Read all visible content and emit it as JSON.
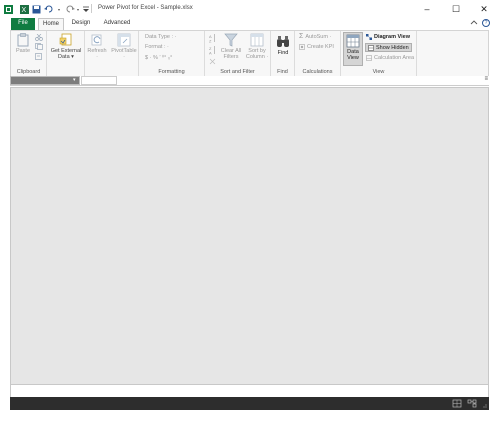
{
  "window": {
    "title": "Power Pivot for Excel - Sample.xlsx",
    "minimize_glyph": "–",
    "maximize_glyph": "☐",
    "close_glyph": "✕"
  },
  "quick_access": [
    "excel-logo-icon",
    "save-icon",
    "undo-icon",
    "redo-icon",
    "customize-icon"
  ],
  "tabs": [
    {
      "label": "File",
      "active": false
    },
    {
      "label": "Home",
      "active": true
    },
    {
      "label": "Design",
      "active": false
    },
    {
      "label": "Advanced",
      "active": false
    }
  ],
  "help_glyph": "?",
  "ribbon": {
    "clipboard": {
      "paste": "Paste",
      "label": "Clipboard"
    },
    "get_external": {
      "label": "Get External\nData ▾"
    },
    "refresh": {
      "label": "Refresh\n·"
    },
    "pivottable": {
      "label": "PivotTable\n·"
    },
    "formatting": {
      "data_type": "Data Type : ·",
      "format": "Format : ·",
      "currency_row": "$ ·  %  ’  ⁰°  ₀°",
      "label": "Formatting"
    },
    "sort_filter": {
      "clear_filters": "Clear All\nFilters",
      "sort_by_column": "Sort by\nColumn ·",
      "label": "Sort and Filter"
    },
    "find": {
      "button": "Find",
      "label": "Find"
    },
    "calculations": {
      "autosum": "AutoSum ·",
      "create_kpi": "Create KPI",
      "label": "Calculations"
    },
    "view": {
      "data_view": "Data\nView",
      "diagram_view": "Diagram View",
      "show_hidden": "Show Hidden",
      "calculation_area": "Calculation Area",
      "label": "View"
    }
  },
  "formula_bar": {
    "dropdown_glyph": "▾",
    "expand_glyph": "≡"
  },
  "colors": {
    "excel_green": "#107c41",
    "status_bar": "#2d2d2d",
    "workspace": "#e6e6e6",
    "accent_blue": "#2b5797"
  }
}
